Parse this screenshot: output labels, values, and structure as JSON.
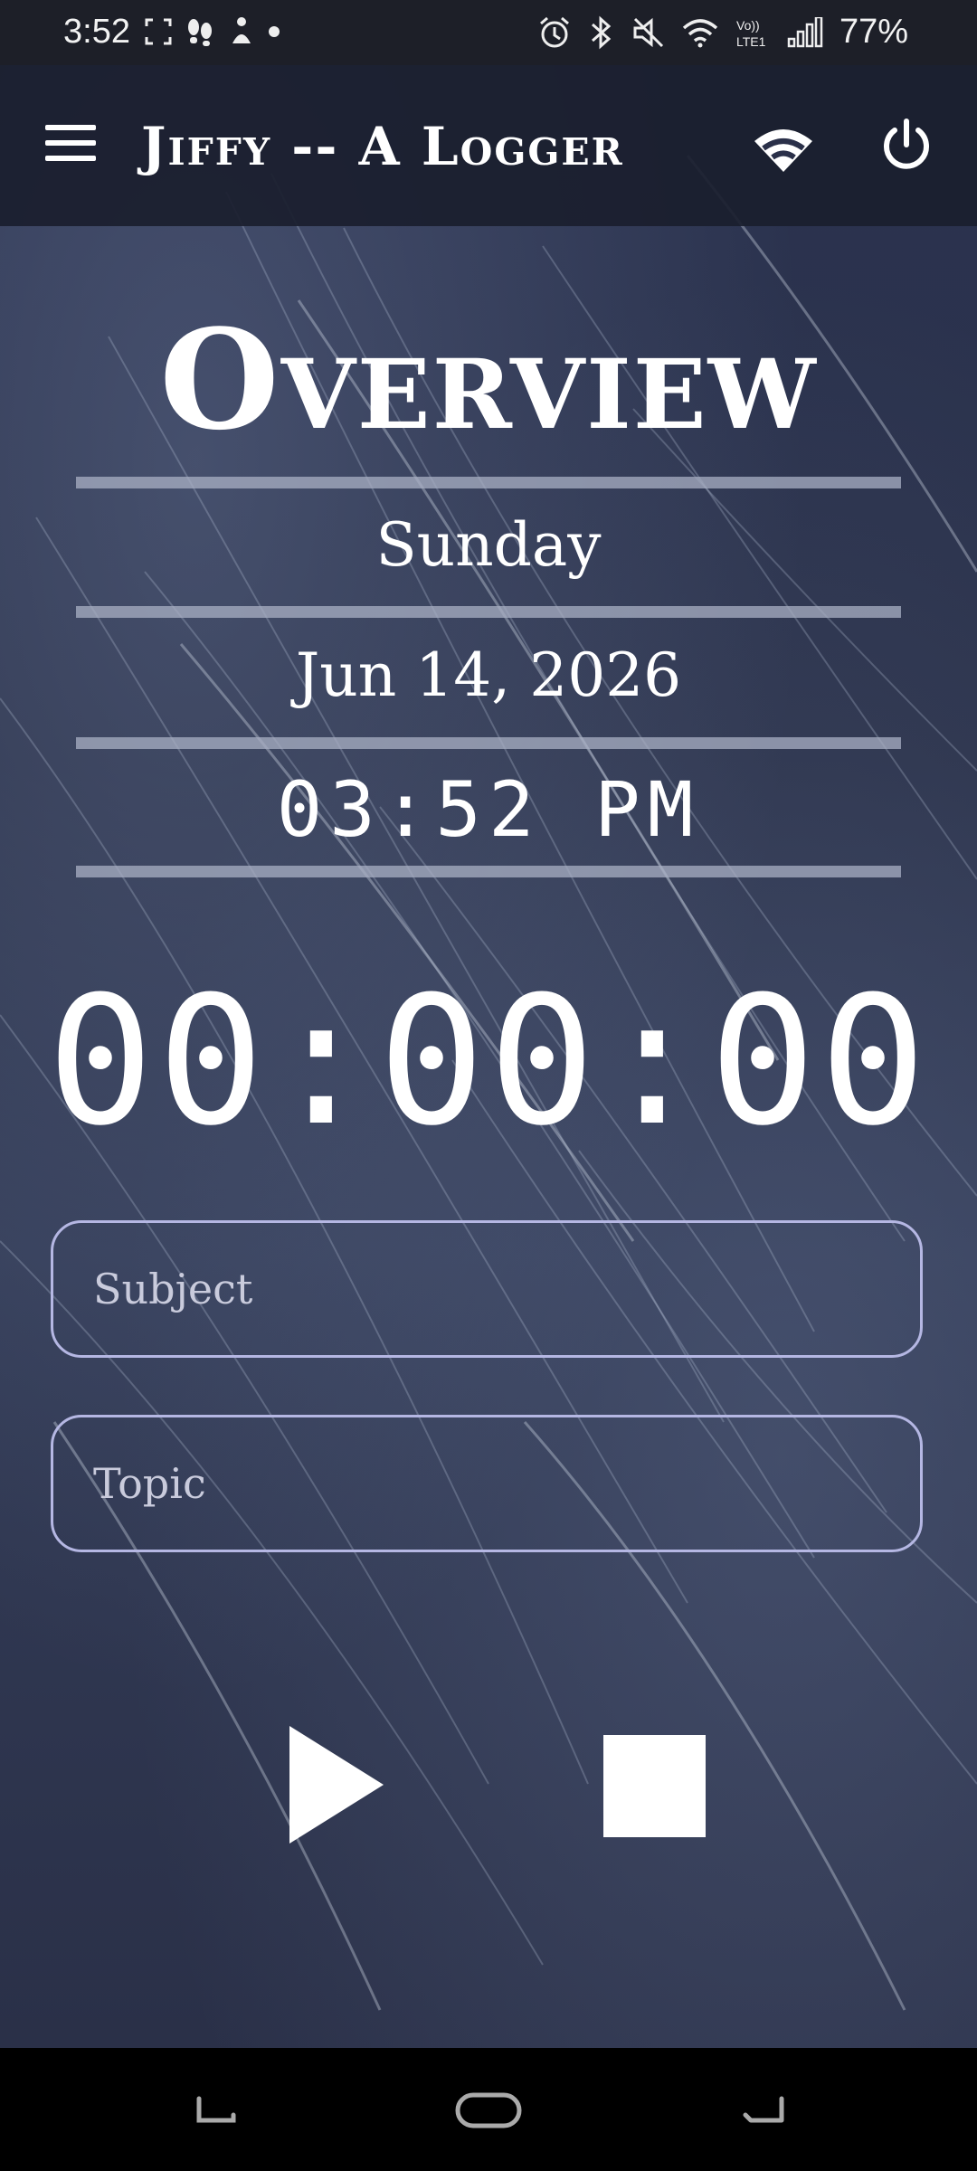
{
  "status_bar": {
    "time": "3:52",
    "battery": "77%",
    "icons": [
      "screenshot-icon",
      "steps-icon",
      "fitness-icon",
      "dot-icon",
      "alarm-icon",
      "bluetooth-icon",
      "mute-icon",
      "wifi-icon",
      "volte-icon",
      "signal-icon"
    ],
    "volte_label": "Vo))\nLTE1"
  },
  "app_bar": {
    "title": "Jiffy -- A Logger",
    "menu_icon": "hamburger-menu-icon",
    "wifi_icon": "wifi-icon",
    "power_icon": "power-icon"
  },
  "main": {
    "heading": "Overview",
    "day": "Sunday",
    "date": "Jun 14, 2026",
    "clock": "03:52 PM",
    "stopwatch": "00:00:00",
    "subject_placeholder": "Subject",
    "topic_placeholder": "Topic",
    "play_icon": "play-icon",
    "stop_icon": "stop-icon"
  },
  "nav_bar": {
    "icons": [
      "recent-apps-icon",
      "home-icon",
      "back-icon"
    ]
  }
}
